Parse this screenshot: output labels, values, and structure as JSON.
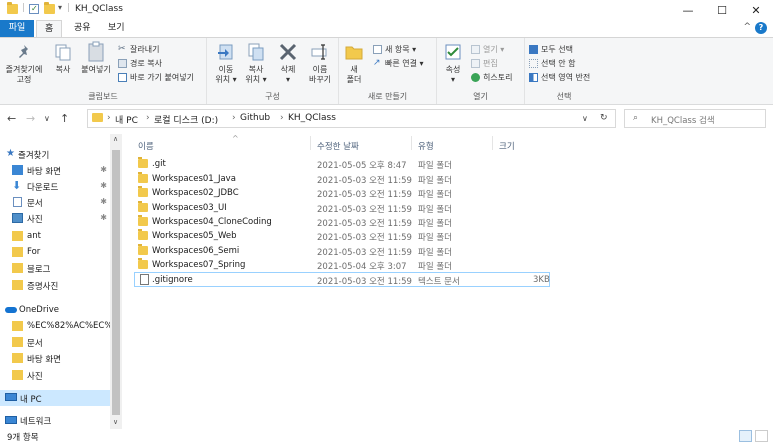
{
  "window": {
    "title": "KH_QClass",
    "minimize": "—",
    "maximize": "☐",
    "close": "✕"
  },
  "ribbon_tabs": [
    "파일",
    "홈",
    "공유",
    "보기"
  ],
  "ribbon": {
    "clipboard": {
      "label": "클립보드",
      "pin": "즐겨찾기에\n고정",
      "pin_l1": "즐겨찾기에",
      "pin_l2": "고정",
      "copy": "복사",
      "paste": "붙여넣기",
      "cut": "잘라내기",
      "copy_path": "경로 복사",
      "paste_shortcut": "바로 가기 붙여넣기"
    },
    "organize": {
      "label": "구성",
      "move_l1": "이동",
      "move_l2": "위치 ▾",
      "copy_l1": "복사",
      "copy_l2": "위치 ▾",
      "delete_l1": "삭제",
      "delete_l2": "▾",
      "rename_l1": "이름",
      "rename_l2": "바꾸기"
    },
    "new": {
      "label": "새로 만들기",
      "new_folder_l1": "새",
      "new_folder_l2": "폴더",
      "new_item": "새 항목 ▾",
      "easy_access": "빠른 연결 ▾"
    },
    "open": {
      "label": "열기",
      "properties_l1": "속성",
      "properties_l2": "▾",
      "open": "열기 ▾",
      "edit": "편집",
      "history": "히스토리"
    },
    "select": {
      "label": "선택",
      "select_all": "모두 선택",
      "select_none": "선택 안 함",
      "invert": "선택 영역 반전"
    }
  },
  "address": {
    "crumbs": [
      "내 PC",
      "로컬 디스크 (D:)",
      "Github",
      "KH_QClass"
    ],
    "search_placeholder": "KH_QClass 검색"
  },
  "sidebar": {
    "items": [
      {
        "label": "즐겨찾기",
        "icon": "star-icon"
      },
      {
        "label": "바탕 화면",
        "icon": "desktop-icon",
        "pinned": true
      },
      {
        "label": "다운로드",
        "icon": "download-icon",
        "pinned": true
      },
      {
        "label": "문서",
        "icon": "document-icon",
        "pinned": true
      },
      {
        "label": "사진",
        "icon": "picture-icon",
        "pinned": true
      },
      {
        "label": "ant",
        "icon": "folder-icon"
      },
      {
        "label": "For",
        "icon": "folder-icon"
      },
      {
        "label": "블로그",
        "icon": "folder-icon"
      },
      {
        "label": "증명사진",
        "icon": "folder-icon"
      },
      {
        "label": "OneDrive",
        "icon": "cloud-icon"
      },
      {
        "label": "%EC%82%AC%EC%",
        "icon": "folder-icon"
      },
      {
        "label": "문서",
        "icon": "folder-icon"
      },
      {
        "label": "바탕 화면",
        "icon": "folder-icon"
      },
      {
        "label": "사진",
        "icon": "folder-icon"
      },
      {
        "label": "내 PC",
        "icon": "pc-icon"
      },
      {
        "label": "네트워크",
        "icon": "network-icon"
      }
    ],
    "pin_glyph": "📌"
  },
  "columns": {
    "name": "이름",
    "date": "수정한 날짜",
    "type": "유형",
    "size": "크기"
  },
  "files": [
    {
      "name": ".git",
      "date": "2021-05-05 오후 8:47",
      "type": "파일 폴더",
      "size": ""
    },
    {
      "name": "Workspaces01_Java",
      "date": "2021-05-03 오전 11:59",
      "type": "파일 폴더",
      "size": ""
    },
    {
      "name": "Workspaces02_JDBC",
      "date": "2021-05-03 오전 11:59",
      "type": "파일 폴더",
      "size": ""
    },
    {
      "name": "Workspaces03_UI",
      "date": "2021-05-03 오전 11:59",
      "type": "파일 폴더",
      "size": ""
    },
    {
      "name": "Workspaces04_CloneCoding",
      "date": "2021-05-03 오전 11:59",
      "type": "파일 폴더",
      "size": ""
    },
    {
      "name": "Workspaces05_Web",
      "date": "2021-05-03 오전 11:59",
      "type": "파일 폴더",
      "size": ""
    },
    {
      "name": "Workspaces06_Semi",
      "date": "2021-05-03 오전 11:59",
      "type": "파일 폴더",
      "size": ""
    },
    {
      "name": "Workspaces07_Spring",
      "date": "2021-05-04 오후 3:07",
      "type": "파일 폴더",
      "size": ""
    },
    {
      "name": ".gitignore",
      "date": "2021-05-03 오전 11:59",
      "type": "텍스트 문서",
      "size": "3KB"
    }
  ],
  "status": {
    "item_count": "9개 항목"
  },
  "colors": {
    "accent": "#1979ca",
    "folder": "#f2c94c",
    "selection": "#cce8ff"
  }
}
